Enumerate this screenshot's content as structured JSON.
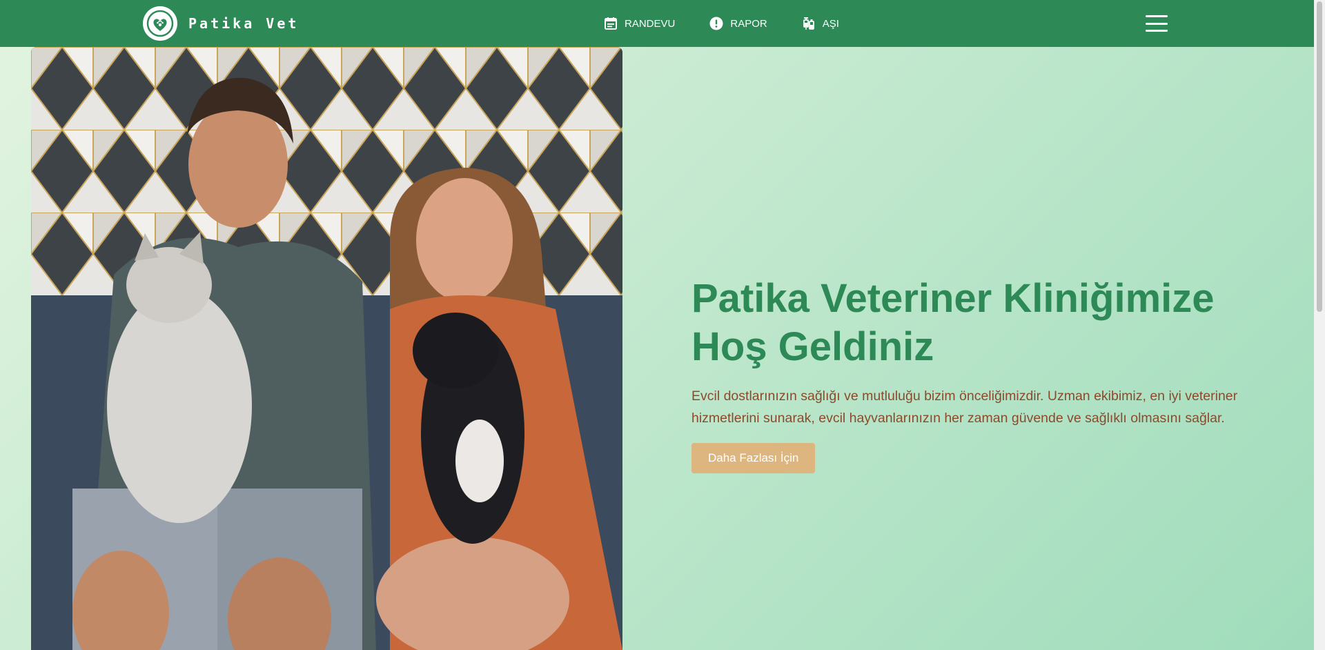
{
  "brand": {
    "name": "Patika Vet",
    "logo_icon": "paw-heart-icon"
  },
  "nav": {
    "items": [
      {
        "label": "RANDEVU",
        "icon": "calendar-icon"
      },
      {
        "label": "RAPOR",
        "icon": "alert-circle-icon"
      },
      {
        "label": "AŞI",
        "icon": "syringe-icon"
      }
    ],
    "menu_icon": "hamburger-menu-icon"
  },
  "hero": {
    "title": "Patika Veteriner Kliniğimize Hoş Geldiniz",
    "description": "Evcil dostlarınızın sağlığı ve mutluluğu bizim önceliğimizdir. Uzman ekibimiz, en iyi veteriner hizmetlerini sunarak, evcil hayvanlarınızın her zaman güvende ve sağlıklı olmasını sağlar.",
    "button_label": "Daha Fazlası İçin",
    "image": "hero-photo"
  },
  "colors": {
    "brand_green": "#2d8a57",
    "text_brown": "#8b4a2b",
    "button_tan": "#ddb57f",
    "background_mint": "#c4e9cf"
  }
}
